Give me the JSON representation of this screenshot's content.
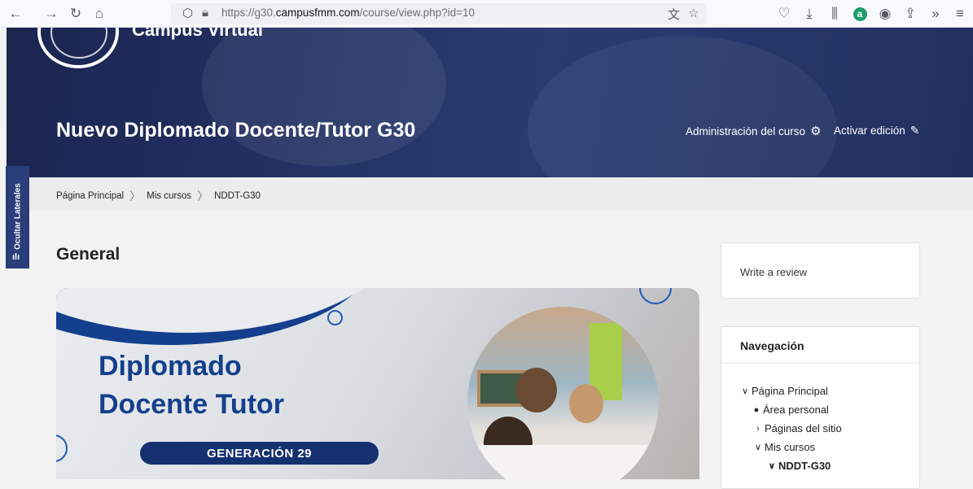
{
  "browser": {
    "url_prefix": "https://g30.",
    "url_domain": "campusfmm.com",
    "url_path": "/course/view.php?id=10"
  },
  "site": {
    "name": "Campus Virtual"
  },
  "header": {
    "course_title": "Nuevo Diplomado Docente/Tutor G30",
    "admin_label": "Administración del curso",
    "edit_label": "Activar edición"
  },
  "sidetab": {
    "label": "Ocultar Laterales"
  },
  "breadcrumb": {
    "items": [
      "Página Principal",
      "Mis cursos",
      "NDDT-G30"
    ]
  },
  "main": {
    "section_title": "General",
    "banner": {
      "line1": "Diplomado",
      "line2": "Docente Tutor",
      "generation": "GENERACIÓN 29"
    }
  },
  "review_block": {
    "label": "Write a review"
  },
  "navigation": {
    "title": "Navegación",
    "items": [
      "Página Principal",
      "Área personal",
      "Páginas del sitio",
      "Mis cursos",
      "NDDT-G30"
    ]
  },
  "colors": {
    "brand_blue": "#143f8c",
    "side_tab": "#2a3f7a"
  }
}
